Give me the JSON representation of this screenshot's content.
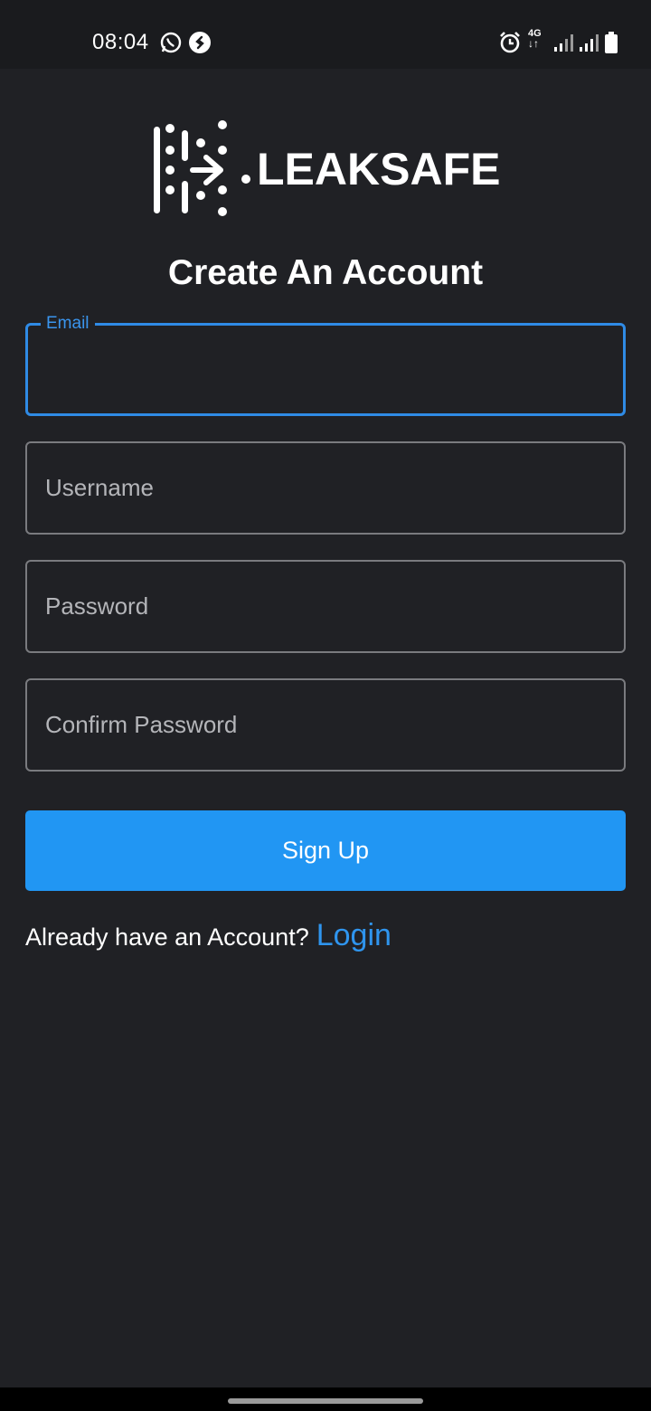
{
  "status_bar": {
    "time": "08:04",
    "left_icons": [
      "whatsapp-icon",
      "shazam-icon"
    ],
    "right_icons": [
      "alarm-icon",
      "network-4g-icon",
      "signal-icon",
      "signal-icon",
      "battery-icon"
    ],
    "network_label": "4G"
  },
  "brand": {
    "name": "LEAKSAFE"
  },
  "page": {
    "title": "Create An Account"
  },
  "form": {
    "email": {
      "label": "Email",
      "value": ""
    },
    "username": {
      "placeholder": "Username",
      "value": ""
    },
    "password": {
      "placeholder": "Password",
      "value": ""
    },
    "confirm_password": {
      "placeholder": "Confirm Password",
      "value": ""
    },
    "submit_label": "Sign Up"
  },
  "footer": {
    "prompt": "Already have an Account?",
    "login_label": "Login"
  },
  "colors": {
    "background": "#202125",
    "accent": "#2196f3",
    "field_border": "#7a7b7f"
  }
}
